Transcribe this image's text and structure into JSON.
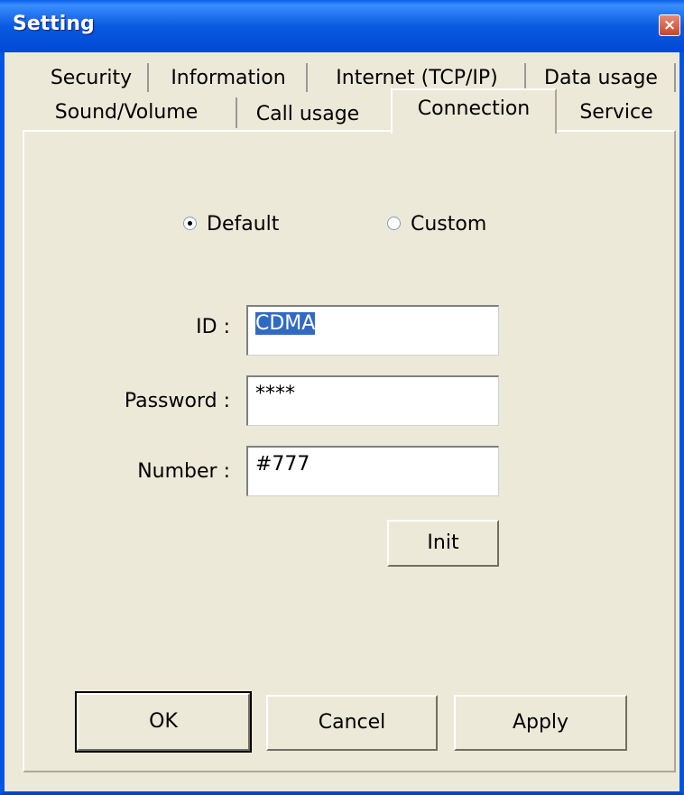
{
  "window": {
    "title": "Setting",
    "close_glyph": "×"
  },
  "tabs_row1": [
    "Security",
    "Information",
    "Internet (TCP/IP)",
    "Data usage"
  ],
  "tabs_row2": [
    "Sound/Volume",
    "Call usage",
    "Connection",
    "Service"
  ],
  "active_tab": "Connection",
  "connection_mode": {
    "options": [
      "Default",
      "Custom"
    ],
    "selected": "Default"
  },
  "fields": {
    "id_label": "ID :",
    "id_value": "CDMA",
    "password_label": "Password :",
    "password_value": "****",
    "number_label": "Number :",
    "number_value": "#777"
  },
  "buttons": {
    "init": "Init",
    "ok": "OK",
    "cancel": "Cancel",
    "apply": "Apply"
  },
  "colors": {
    "titlebar": "#0055e5",
    "dialog_bg": "#ece9d8",
    "selection": "#316ac5"
  }
}
